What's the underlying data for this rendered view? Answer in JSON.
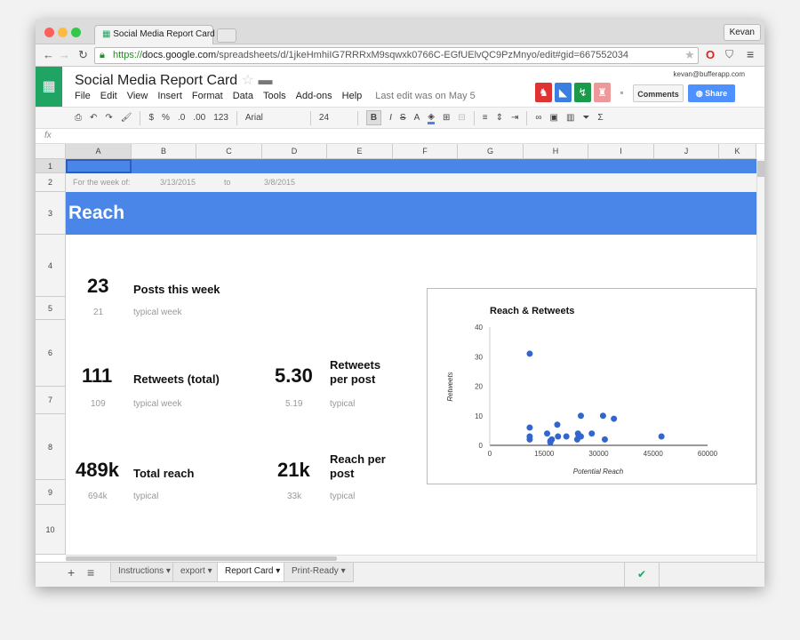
{
  "browser": {
    "tab_title": "Social Media Report Card",
    "user": "Kevan",
    "url_scheme": "https://",
    "url_host": "docs.google.com",
    "url_path": "/spreadsheets/d/1jkeHmhiIG7RRRxM9sqwxk0766C-EGfUElvQC9PzMnyo/edit#gid=667552034"
  },
  "doc": {
    "title": "Social Media Report Card",
    "account": "kevan@bufferapp.com",
    "menu": [
      "File",
      "Edit",
      "View",
      "Insert",
      "Format",
      "Data",
      "Tools",
      "Add-ons",
      "Help"
    ],
    "last_edit": "Last edit was on May 5",
    "comments": "Comments",
    "share": "Share"
  },
  "toolbar": {
    "currency": "$",
    "percent": "%",
    "dec_less": ".0",
    "dec_more": ".00",
    "format": "123",
    "font": "Arial",
    "size": "24",
    "bold": "B",
    "italic": "I",
    "strike": "S",
    "textcolor": "A",
    "sum": "Σ"
  },
  "formula_icon": "fx",
  "columns": [
    "A",
    "B",
    "C",
    "D",
    "E",
    "F",
    "G",
    "H",
    "I",
    "J",
    "K"
  ],
  "rows": [
    "1",
    "2",
    "3",
    "4",
    "5",
    "6",
    "7",
    "8",
    "9",
    "10"
  ],
  "sheet": {
    "week_label": "For the week of:",
    "week_start": "3/13/2015",
    "week_to": "to",
    "week_end": "3/8/2015",
    "section": "Reach",
    "posts": {
      "value": "23",
      "label": "Posts this week",
      "typical_value": "21",
      "typical_label": "typical week"
    },
    "retweets": {
      "value": "111",
      "label": "Retweets (total)",
      "typical_value": "109",
      "typical_label": "typical week"
    },
    "rt_per_post": {
      "value": "5.30",
      "label": "Retweets per post",
      "typical_value": "5.19",
      "typical_label": "typical"
    },
    "reach": {
      "value": "489k",
      "label": "Total reach",
      "typical_value": "694k",
      "typical_label": "typical"
    },
    "reach_per_post": {
      "value": "21k",
      "label": "Reach per post",
      "typical_value": "33k",
      "typical_label": "typical"
    }
  },
  "chart_data": {
    "type": "scatter",
    "title": "Reach & Retweets",
    "xlabel": "Potential Reach",
    "ylabel": "Retweets",
    "xlim": [
      0,
      60000
    ],
    "ylim": [
      0,
      40
    ],
    "xticks": [
      "0",
      "15000",
      "30000",
      "45000",
      "60000"
    ],
    "yticks": [
      "0",
      "10",
      "20",
      "30",
      "40"
    ],
    "color": "#3366cc",
    "points": [
      [
        11000,
        31
      ],
      [
        11000,
        6
      ],
      [
        11000,
        3
      ],
      [
        11000,
        2
      ],
      [
        15800,
        4
      ],
      [
        16700,
        1.5
      ],
      [
        16700,
        1
      ],
      [
        17100,
        2
      ],
      [
        18600,
        7
      ],
      [
        18800,
        3
      ],
      [
        21100,
        3
      ],
      [
        24100,
        2
      ],
      [
        24300,
        4
      ],
      [
        24500,
        3
      ],
      [
        25100,
        10
      ],
      [
        25100,
        3
      ],
      [
        28100,
        4
      ],
      [
        31200,
        10
      ],
      [
        31700,
        2
      ],
      [
        34200,
        9
      ],
      [
        47300,
        3
      ]
    ]
  },
  "sheet_tabs": [
    "Instructions",
    "export",
    "Report Card",
    "Print-Ready"
  ],
  "active_tab": "Report Card",
  "colors": {
    "accent": "#4a86e8",
    "sheets_green": "#1fa463",
    "share": "#4d90fe"
  }
}
